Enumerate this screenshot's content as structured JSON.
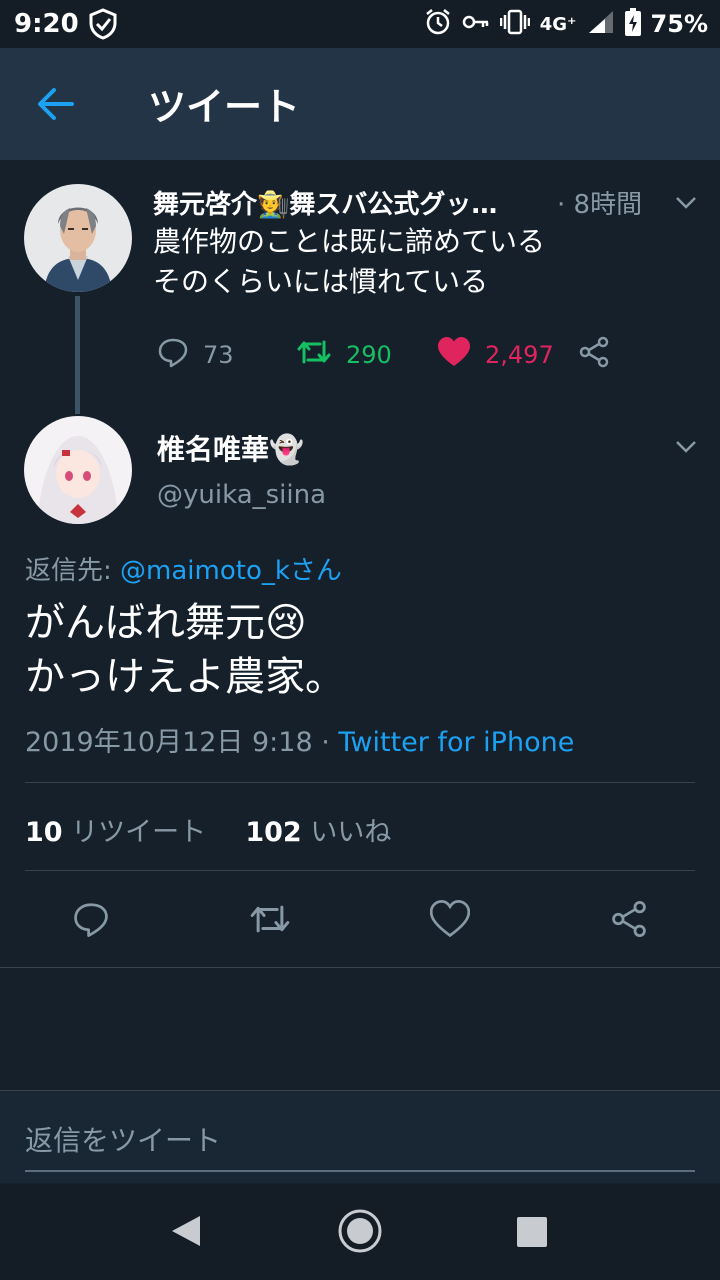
{
  "status": {
    "time": "9:20",
    "network": "4G⁺",
    "battery": "75%"
  },
  "header": {
    "title": "ツイート"
  },
  "parent_tweet": {
    "name": "舞元啓介🧑‍🌾舞スバ公式グッ…",
    "time": "· 8時間",
    "text": "農作物のことは既に諦めている\nそのくらいには慣れている",
    "replies": "73",
    "retweets": "290",
    "likes": "2,497"
  },
  "main_tweet": {
    "name": "椎名唯華👻",
    "handle": "@yuika_siina",
    "reply_prefix": "返信先: ",
    "reply_target": "@maimoto_kさん",
    "text": "がんばれ舞元😢\nかっけえよ農家。",
    "date": "2019年10月12日 9:18 · ",
    "source": "Twitter for iPhone",
    "retweet_count": "10",
    "retweet_label": " リツイート",
    "like_count": "102",
    "like_label": " いいね"
  },
  "reply_box": {
    "placeholder": "返信をツイート"
  },
  "colors": {
    "background": "#15202b",
    "header": "#243447",
    "accent": "#1da1f2",
    "retweet": "#17bf63",
    "like": "#e0245e",
    "muted": "#8899a6"
  },
  "icons": [
    "shield-check-icon",
    "alarm-icon",
    "key-icon",
    "vibrate-icon",
    "signal-icon",
    "battery-charging-icon",
    "back-arrow-icon",
    "chevron-down-icon",
    "reply-icon",
    "retweet-icon",
    "heart-icon",
    "share-icon",
    "nav-back-icon",
    "nav-home-icon",
    "nav-recents-icon"
  ]
}
